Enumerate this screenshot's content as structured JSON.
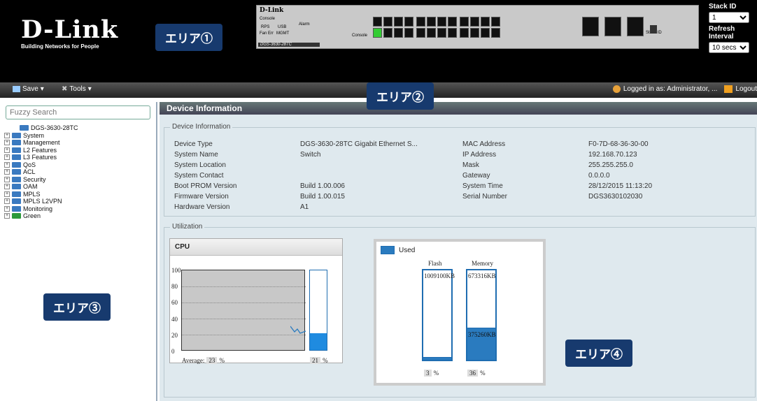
{
  "header": {
    "logo": "D-Link",
    "tagline": "Building Networks for People",
    "panel_brand": "D-Link",
    "panel_model": "DGS-3630-28TC",
    "panel_labels": {
      "console": "Console",
      "rps": "RPS",
      "usb": "USB",
      "fan": "Fan",
      "err": "Err",
      "mgmt": "MGMT",
      "alarm": "Alarm",
      "console2": "Console",
      "stack_id": "Stack ID"
    },
    "stack_id_label": "Stack ID",
    "stack_id_value": "1",
    "refresh_label": "Refresh Interval",
    "refresh_value": "10 secs"
  },
  "badges": {
    "a1": "エリア①",
    "a2": "エリア②",
    "a3": "エリア③",
    "a4": "エリア④"
  },
  "toolbar": {
    "save": "Save",
    "tools": "Tools",
    "user": "Logged in as: Administrator, ...",
    "logout": "Logout"
  },
  "sidebar": {
    "search_placeholder": "Fuzzy Search",
    "root": "DGS-3630-28TC",
    "items": [
      "System",
      "Management",
      "L2 Features",
      "L3 Features",
      "QoS",
      "ACL",
      "Security",
      "OAM",
      "MPLS",
      "MPLS L2VPN",
      "Monitoring",
      "Green"
    ]
  },
  "main": {
    "title": "Device Information",
    "info_legend": "Device Information",
    "left_rows": [
      {
        "label": "Device Type",
        "value": "DGS-3630-28TC Gigabit Ethernet S..."
      },
      {
        "label": "System Name",
        "value": "Switch"
      },
      {
        "label": "System Location",
        "value": ""
      },
      {
        "label": "System Contact",
        "value": ""
      },
      {
        "label": "Boot PROM Version",
        "value": "Build 1.00.006"
      },
      {
        "label": "Firmware Version",
        "value": "Build 1.00.015"
      },
      {
        "label": "Hardware Version",
        "value": "A1"
      }
    ],
    "right_rows": [
      {
        "label": "MAC Address",
        "value": "F0-7D-68-36-30-00"
      },
      {
        "label": "IP Address",
        "value": "192.168.70.123"
      },
      {
        "label": "Mask",
        "value": "255.255.255.0"
      },
      {
        "label": "Gateway",
        "value": "0.0.0.0"
      },
      {
        "label": "System Time",
        "value": "28/12/2015 11:13:20"
      },
      {
        "label": "Serial Number",
        "value": "DGS3630102030"
      }
    ],
    "util_legend": "Utilization",
    "cpu": {
      "title": "CPU",
      "ticks": [
        "100",
        "80",
        "60",
        "40",
        "20",
        "0"
      ],
      "average_label": "Average:",
      "average_value": "23",
      "unit": "%",
      "current": "21",
      "current_fraction": 0.21
    },
    "memory": {
      "legend": "Used",
      "flash": {
        "name": "Flash",
        "total": "1009100KB",
        "percent": "3",
        "fraction": 0.03
      },
      "memory": {
        "name": "Memory",
        "total": "673316KB",
        "used": "375260KB",
        "percent": "36",
        "fraction": 0.36
      },
      "unit": "%"
    }
  }
}
